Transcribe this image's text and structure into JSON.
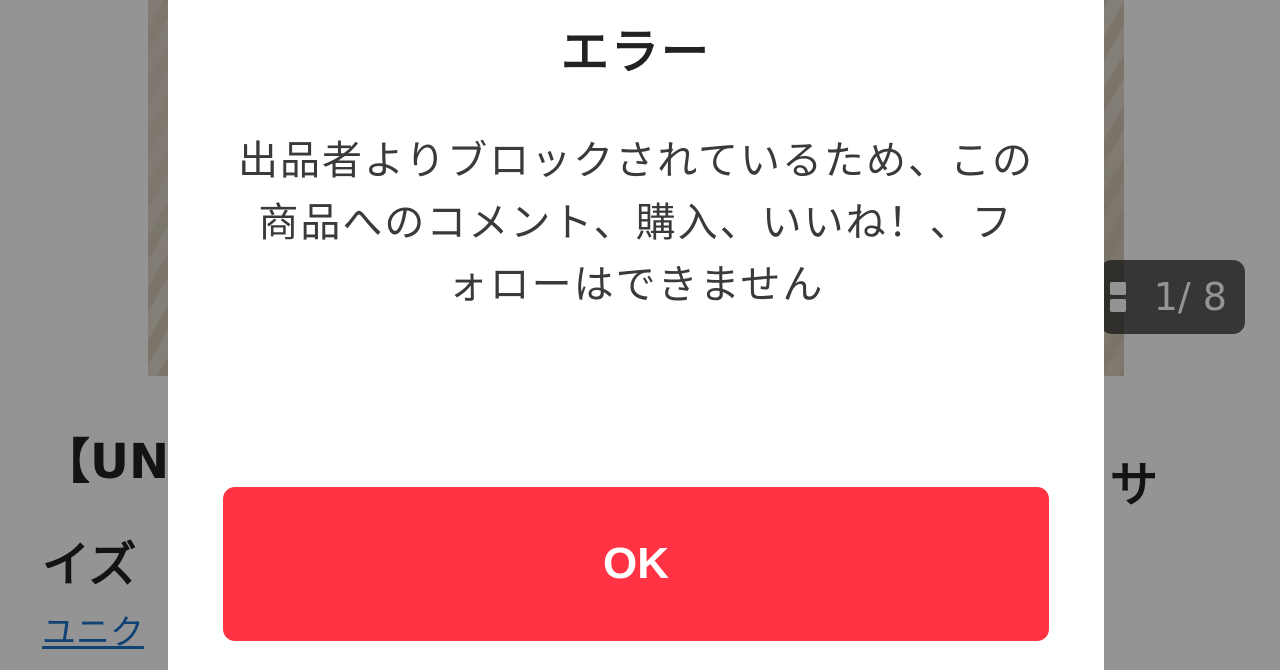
{
  "background": {
    "image_counter": "1/ 8",
    "product_title_start": "【UN",
    "product_title_end": "サ",
    "product_title_line2": "イズ",
    "brand_link": "ユニク"
  },
  "dialog": {
    "title": "エラー",
    "message": "出品者よりブロックされているため、この商品へのコメント、購入、いいね！、フォローはできません",
    "ok_label": "OK"
  },
  "colors": {
    "ok_button": "#ff3344",
    "link": "#1e73c8"
  }
}
